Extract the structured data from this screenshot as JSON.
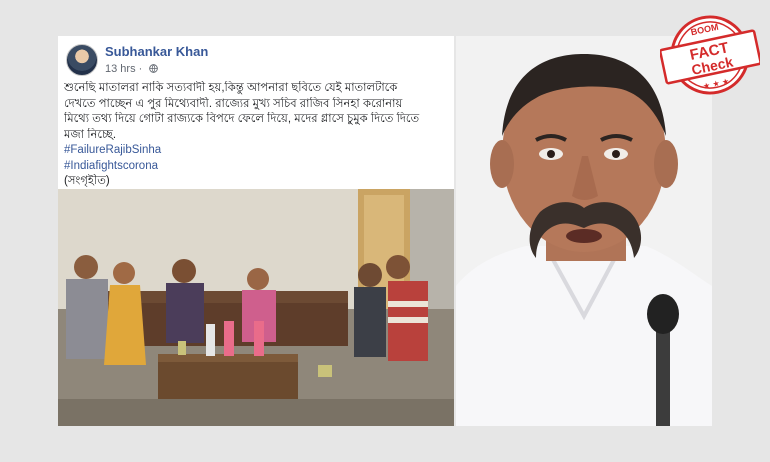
{
  "post": {
    "author_name": "Subhankar Khan",
    "timestamp": "13 hrs · ",
    "privacy_icon": "globe-icon",
    "body_lines": [
      "শুনেছি মাতালরা নাকি সত্যবাদী হয়,কিন্তু আপনারা ছবিতে যেই মাতালটাকে",
      "দেখতে পাচ্ছেন এ পুর মিথ্যেবাদী. রাজ্যের মুখ্য সচিব রাজিব সিনহা করোনায়",
      "মিথ্যে তথ্য দিয়ে গোটা রাজ্যকে বিপদে ফেলে দিয়ে, মদের গ্লাসে চুমুক দিতে দিতে",
      "মজা নিচ্ছে."
    ],
    "hashtags": [
      "#FailureRajibSinha",
      "#Indiafightscorona"
    ],
    "credit": "(সংগৃহীত)"
  },
  "stamp": {
    "top_word": "BOOM",
    "line1": "FACT",
    "line2": "Check",
    "stars": "★ ★ ★",
    "color": "#d42b2b"
  },
  "colors": {
    "background": "#e6e6e6",
    "author_link": "#385898",
    "hashtag": "#385898"
  }
}
